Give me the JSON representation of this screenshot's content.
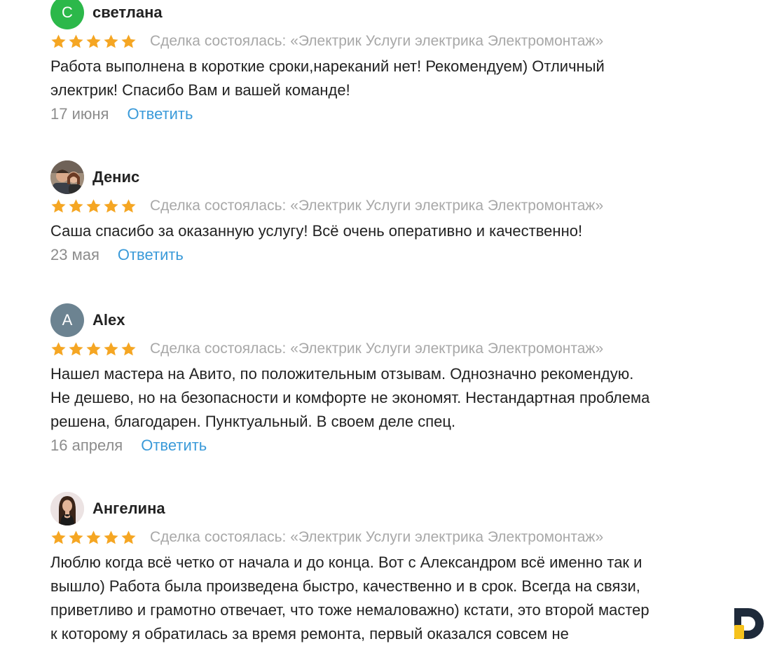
{
  "colors": {
    "star": "#f5a623",
    "link": "#3a9ad9",
    "muted": "#a8a8a8"
  },
  "reviews": [
    {
      "avatar_letter": "С",
      "avatar_color": "#2cb84a",
      "name": "светлана",
      "rating": 5,
      "deal": "Сделка состоялась: «Электрик Услуги электрика Электромонтаж»",
      "text": "Работа выполнена в короткие сроки,нареканий нет! Рекомендуем) Отличный\nэлектрик! Спасибо Вам и вашей команде!",
      "date": "17 июня",
      "reply": "Ответить"
    },
    {
      "avatar_icon": "photo-avatar-icon",
      "name": "Денис",
      "rating": 5,
      "deal": "Сделка состоялась: «Электрик Услуги электрика Электромонтаж»",
      "text": "Саша спасибо за оказанную услугу! Всё очень оперативно и качественно!",
      "date": "23 мая",
      "reply": "Ответить"
    },
    {
      "avatar_letter": "A",
      "avatar_color": "#6c8391",
      "name": "Alex",
      "rating": 5,
      "deal": "Сделка состоялась: «Электрик Услуги электрика Электромонтаж»",
      "text": "Нашел мастера на Авито, по положительным отзывам. Однозначно рекомендую.\nНе дешево, но на безопасности и комфорте не экономят. Нестандартная проблема\nрешена, благодарен. Пунктуальный. В своем деле спец.",
      "date": "16 апреля",
      "reply": "Ответить"
    },
    {
      "avatar_icon": "photo-avatar-icon",
      "name": "Ангелина",
      "rating": 5,
      "deal": "Сделка состоялась: «Электрик Услуги электрика Электромонтаж»",
      "text": "Люблю когда всё четко от начала и до конца. Вот с Александром всё именно так и\nвышло) Работа была произведена быстро, качественно и в срок. Всегда на связи,\nприветливо и грамотно отвечает, что тоже немаловажно) кстати, это второй мастер\nк которому я обратилась за время ремонта, первый оказался совсем не"
    }
  ],
  "watermark_icon": "brand-logo-icon"
}
